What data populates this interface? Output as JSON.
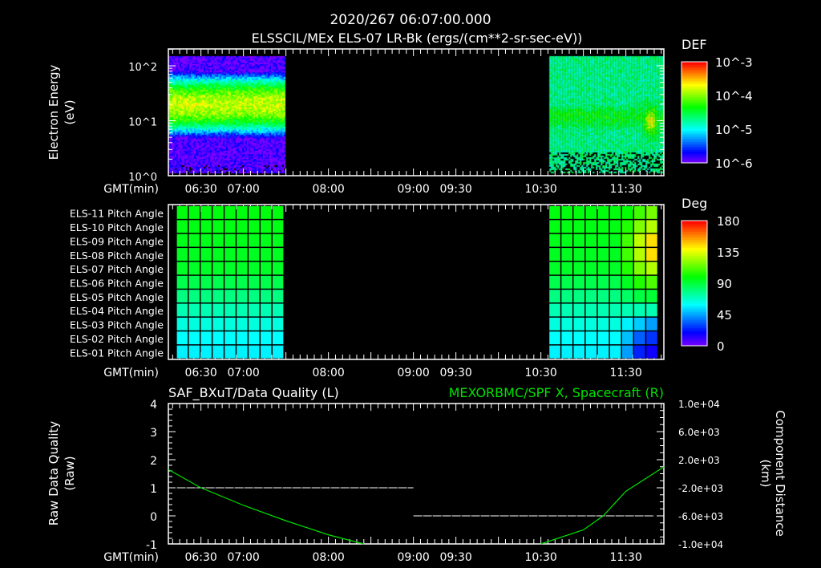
{
  "header": {
    "timestamp": "2020/267 06:07:00.000",
    "title": "ELSSCIL/MEx ELS-07 LR-Bk  (ergs/(cm**2-sr-sec-eV))"
  },
  "time_axis": {
    "label": "GMT(min)",
    "ticks": [
      "06:30",
      "07:00",
      "08:00",
      "09:00",
      "09:30",
      "10:30",
      "11:30"
    ],
    "tick_minutes": [
      390,
      420,
      480,
      540,
      570,
      630,
      690
    ],
    "range": [
      "06:07",
      "11:57"
    ]
  },
  "chart_data": [
    {
      "type": "heatmap",
      "ylabel": "Electron Energy",
      "yunits": "(eV)",
      "yscale": "log",
      "ylim": [
        1,
        200
      ],
      "yticks": [
        "10^0",
        "10^1",
        "10^2"
      ],
      "colorbar": {
        "title": "DEF",
        "scale": "log",
        "range": [
          1e-06,
          0.001
        ],
        "ticks": [
          "10^-3",
          "10^-4",
          "10^-5",
          "10^-6"
        ]
      },
      "data_blocks": [
        {
          "start": "06:07",
          "end": "07:29",
          "peak_energy_eV": 20,
          "peak_def": 0.00015,
          "band_eV": [
            6,
            40
          ]
        },
        {
          "start": "10:36",
          "end": "11:57",
          "peak_energy_eV": 12,
          "peak_def": 4e-05,
          "band_eV": [
            5,
            25
          ],
          "enhancement": {
            "time": "11:47",
            "energy_eV": 10,
            "def": 0.0002
          }
        }
      ]
    },
    {
      "type": "heatmap",
      "colorbar": {
        "title": "Deg",
        "range": [
          0,
          180
        ],
        "ticks": [
          "180",
          "135",
          "90",
          "45",
          "0"
        ]
      },
      "rows": [
        "ELS-11 Pitch Angle",
        "ELS-10 Pitch Angle",
        "ELS-09 Pitch Angle",
        "ELS-08 Pitch Angle",
        "ELS-07 Pitch Angle",
        "ELS-06 Pitch Angle",
        "ELS-05 Pitch Angle",
        "ELS-04 Pitch Angle",
        "ELS-03 Pitch Angle",
        "ELS-02 Pitch Angle",
        "ELS-01 Pitch Angle"
      ],
      "blocks": [
        {
          "start": "06:13",
          "end": "07:29",
          "values": [
            [
              98,
              98,
              98,
              98,
              98,
              98,
              98,
              98,
              98
            ],
            [
              97,
              97,
              97,
              97,
              97,
              97,
              97,
              97,
              97
            ],
            [
              96,
              96,
              96,
              96,
              96,
              96,
              96,
              96,
              96
            ],
            [
              95,
              95,
              95,
              95,
              95,
              95,
              95,
              95,
              95
            ],
            [
              94,
              94,
              94,
              94,
              94,
              94,
              94,
              94,
              94
            ],
            [
              88,
              88,
              88,
              88,
              88,
              88,
              88,
              88,
              88
            ],
            [
              80,
              80,
              80,
              80,
              80,
              80,
              80,
              80,
              80
            ],
            [
              72,
              72,
              72,
              72,
              72,
              72,
              72,
              72,
              72
            ],
            [
              65,
              65,
              65,
              65,
              65,
              65,
              65,
              65,
              65
            ],
            [
              60,
              60,
              60,
              60,
              60,
              60,
              60,
              60,
              60
            ],
            [
              58,
              58,
              58,
              58,
              58,
              58,
              58,
              58,
              58
            ]
          ]
        },
        {
          "start": "10:36",
          "end": "11:53",
          "values": [
            [
              98,
              98,
              98,
              98,
              98,
              98,
              100,
              110,
              118
            ],
            [
              97,
              97,
              97,
              97,
              97,
              97,
              105,
              120,
              128
            ],
            [
              96,
              96,
              96,
              96,
              96,
              96,
              110,
              130,
              145
            ],
            [
              95,
              95,
              95,
              95,
              95,
              95,
              110,
              128,
              145
            ],
            [
              94,
              94,
              94,
              94,
              94,
              94,
              105,
              120,
              128
            ],
            [
              88,
              88,
              88,
              88,
              88,
              88,
              95,
              105,
              112
            ],
            [
              80,
              80,
              80,
              80,
              80,
              80,
              85,
              90,
              92
            ],
            [
              72,
              72,
              72,
              72,
              72,
              72,
              72,
              72,
              72
            ],
            [
              65,
              65,
              65,
              65,
              65,
              65,
              58,
              52,
              45
            ],
            [
              60,
              60,
              60,
              60,
              60,
              60,
              50,
              35,
              28
            ],
            [
              58,
              58,
              58,
              58,
              58,
              58,
              45,
              25,
              18
            ]
          ]
        }
      ]
    },
    {
      "type": "line",
      "left_title": "SAF_BXuT/Data Quality (L)",
      "right_title": "MEXORBMC/SPF X, Spacecraft (R)",
      "ylabel_left": "Raw Data Quality",
      "ylabel_left_units": "(Raw)",
      "ylabel_right": "Component Distance",
      "ylabel_right_units": "(km)",
      "ylim_left": [
        -1,
        4
      ],
      "yticks_left": [
        "4",
        "3",
        "2",
        "1",
        "0",
        "-1"
      ],
      "ylim_right": [
        -10000,
        10000
      ],
      "yticks_right": [
        "1.0e+04",
        "6.0e+03",
        "2.0e+03",
        "-2.0e+03",
        "-6.0e+03",
        "-1.0e+04"
      ],
      "series": [
        {
          "axis": "left",
          "color": "#ffffff",
          "style": "dashed",
          "points": [
            [
              "06:13",
              1
            ],
            [
              "09:00",
              1
            ],
            [
              "09:00",
              0
            ],
            [
              "11:50",
              0
            ]
          ]
        },
        {
          "axis": "right",
          "color": "#00e000",
          "style": "solid",
          "points": [
            [
              "06:07",
              600
            ],
            [
              "06:30",
              -2000
            ],
            [
              "07:00",
              -4500
            ],
            [
              "07:30",
              -6700
            ],
            [
              "08:00",
              -8700
            ],
            [
              "08:25",
              -10000
            ],
            [
              "10:30",
              -10000
            ],
            [
              "11:00",
              -8000
            ],
            [
              "11:14",
              -6000
            ],
            [
              "11:30",
              -2500
            ],
            [
              "11:57",
              1000
            ]
          ]
        }
      ]
    }
  ]
}
